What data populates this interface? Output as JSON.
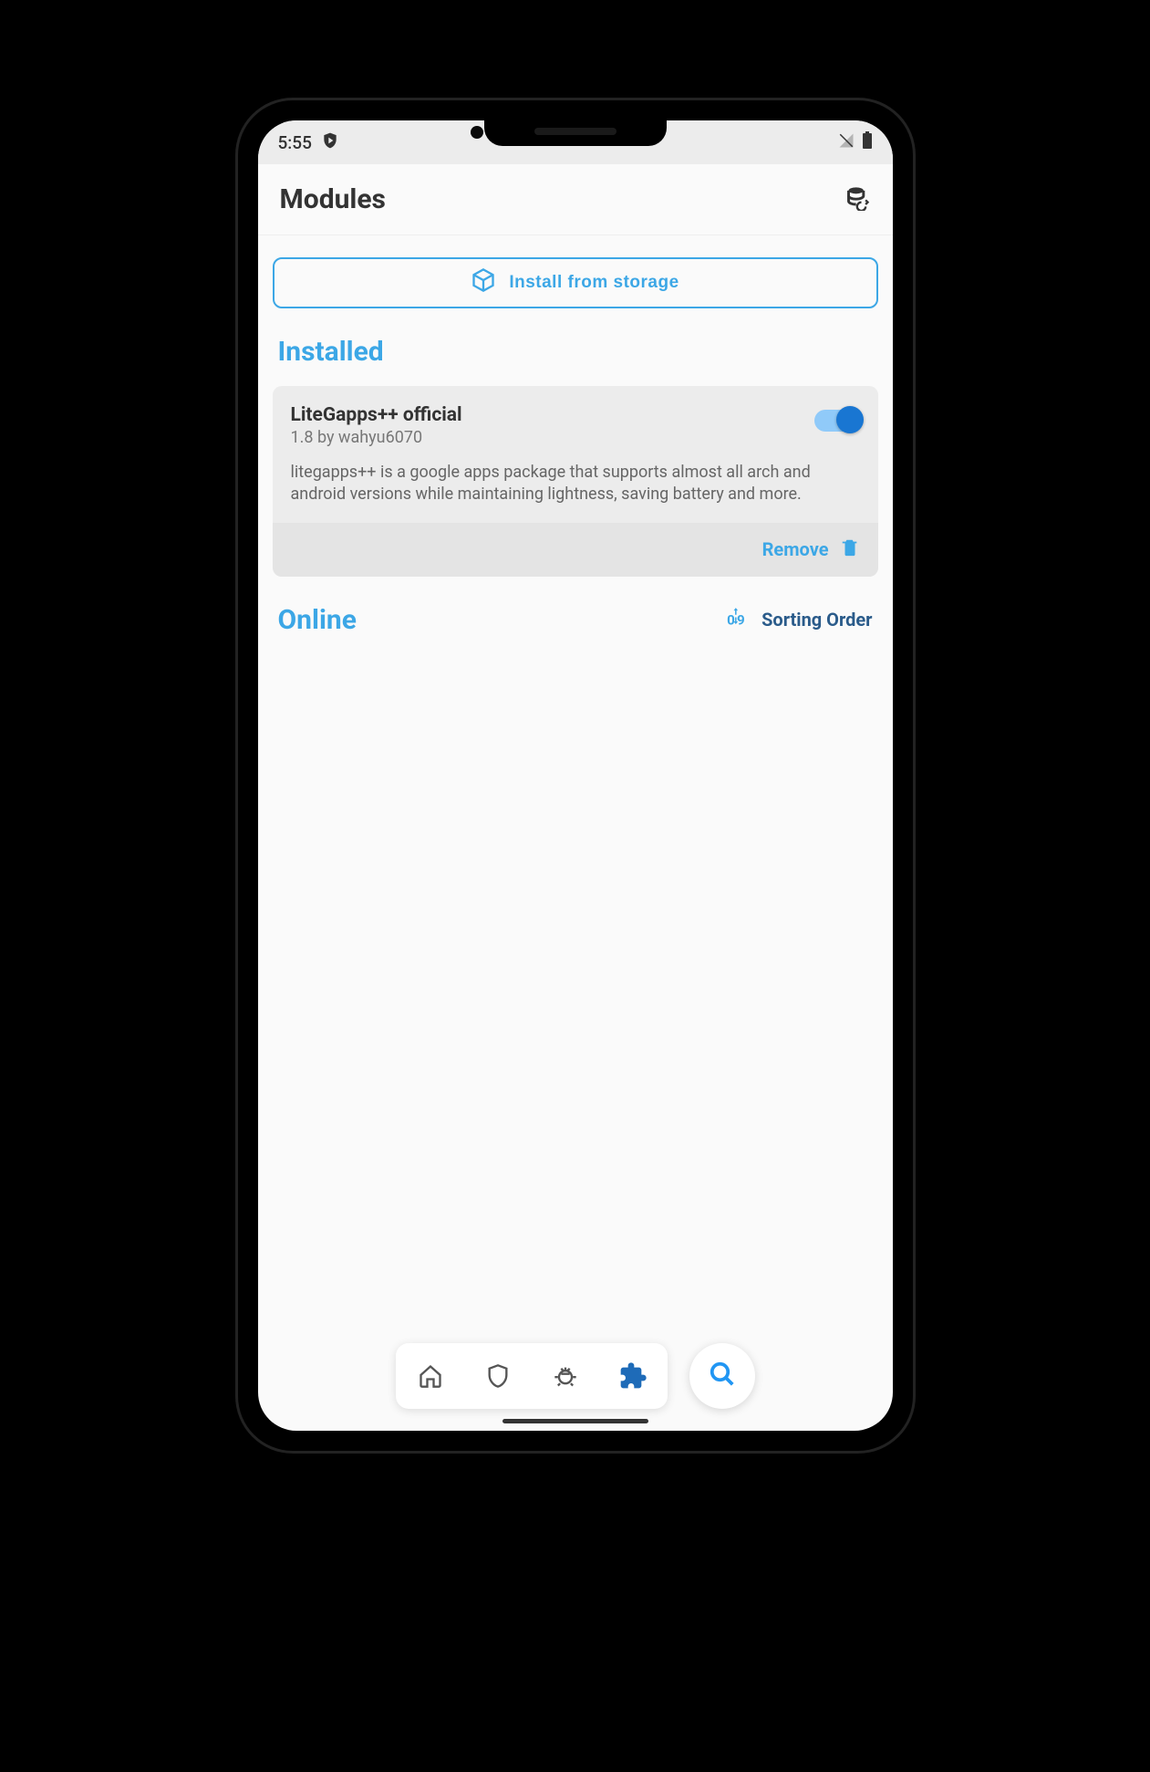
{
  "status": {
    "time": "5:55"
  },
  "header": {
    "title": "Modules"
  },
  "install_button": "Install from storage",
  "sections": {
    "installed": "Installed",
    "online": "Online"
  },
  "module": {
    "name": "LiteGapps++ official",
    "version": "1.8 by wahyu6070",
    "description": "litegapps++ is a google apps package that supports almost all arch and android versions while maintaining lightness, saving battery and more.",
    "enabled": true,
    "remove_label": "Remove"
  },
  "sorting": {
    "label": "Sorting Order",
    "badge": "09"
  },
  "colors": {
    "accent": "#3ca7e6",
    "dark_accent": "#2a5b8a",
    "toggle_on": "#1976d2"
  }
}
